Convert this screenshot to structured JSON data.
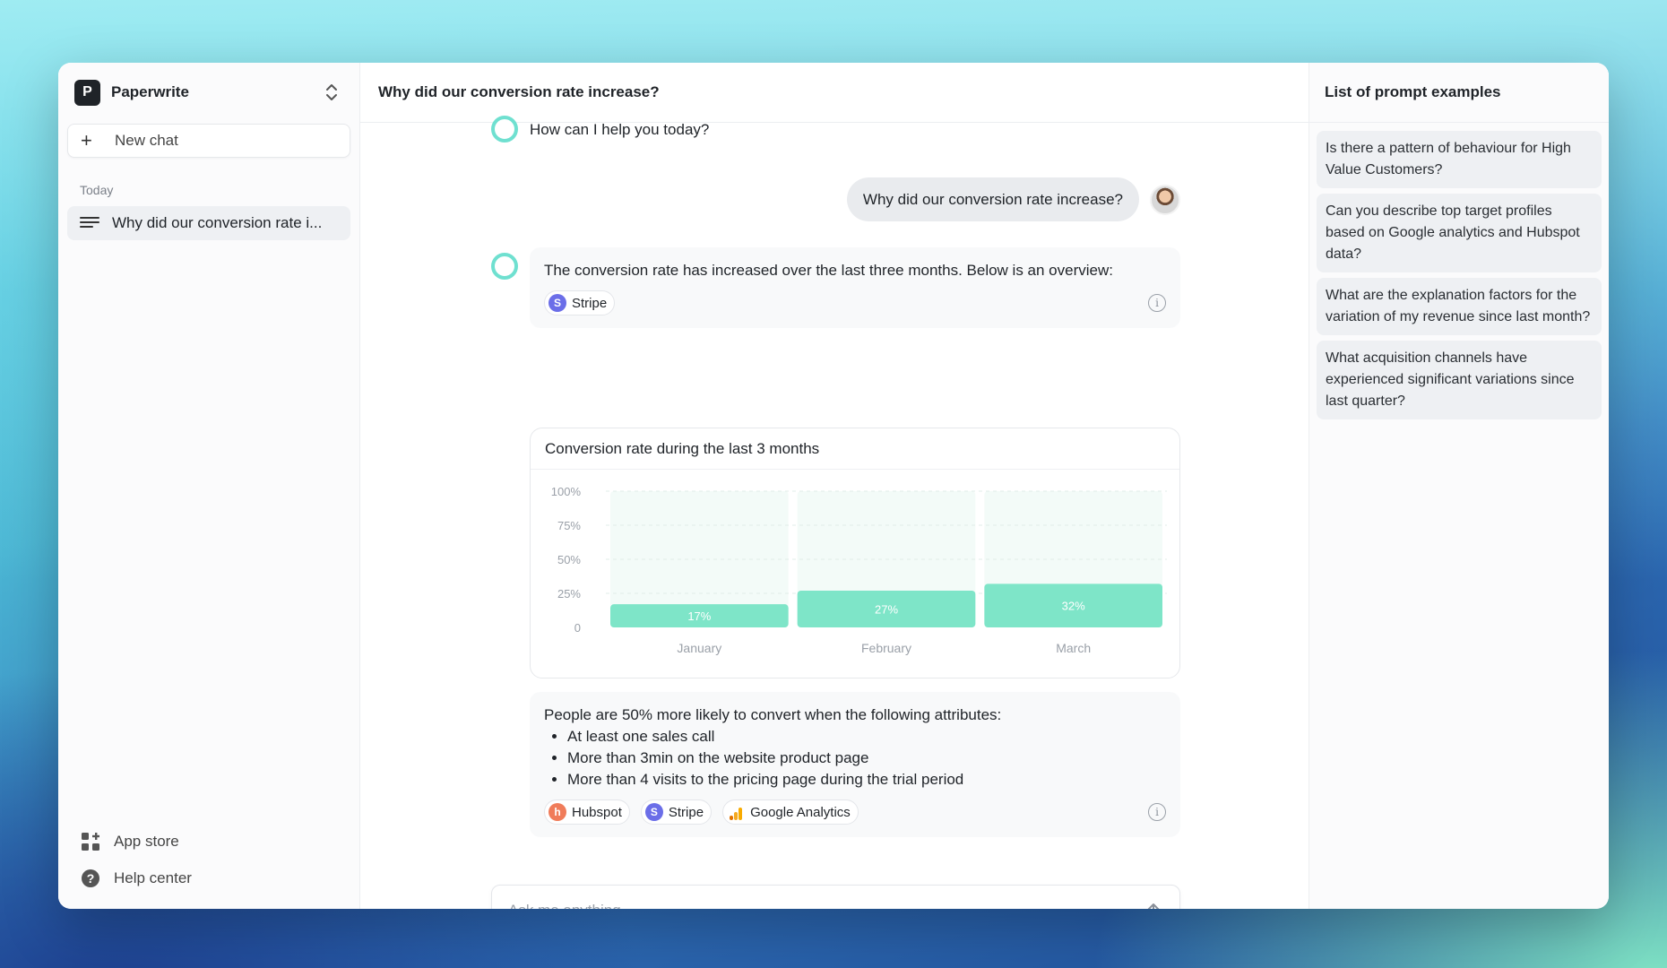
{
  "app": {
    "workspace_name": "Paperwrite",
    "workspace_initial": "P"
  },
  "sidebar": {
    "new_chat_label": "New chat",
    "section_today": "Today",
    "history": [
      {
        "label": "Why did our conversion rate i..."
      }
    ],
    "bottom_links": [
      {
        "label": "App store",
        "icon": "app-store-icon"
      },
      {
        "label": "Help center",
        "icon": "help-icon"
      }
    ]
  },
  "main": {
    "title": "Why did our conversion rate increase?",
    "greeting": "How can I help you today?",
    "user_message": "Why did our conversion rate increase?",
    "answer_1": {
      "text": "The conversion rate has increased over the last three months. Below is an overview:",
      "sources": [
        {
          "label": "Stripe",
          "initial": "S",
          "color": "#6b6ee8"
        }
      ]
    },
    "answer_2": {
      "intro": "People are 50% more likely to convert when the following attributes:",
      "bullets": [
        "At least one sales call",
        "More than 3min on the website product page",
        "More than 4 visits to the pricing page during the trial period"
      ],
      "sources": [
        {
          "label": "Hubspot",
          "initial": "h",
          "color": "#f07c5a"
        },
        {
          "label": "Stripe",
          "initial": "S",
          "color": "#6b6ee8"
        },
        {
          "label": "Google Analytics",
          "initial": "",
          "color": "#f4a922"
        }
      ]
    },
    "input_placeholder": "Ask me anything..."
  },
  "right_panel": {
    "title": "List of prompt examples",
    "prompts": [
      "Is there a pattern of behaviour for High Value Customers?",
      "Can you describe top target profiles based on Google analytics and Hubspot data?",
      "What are the explanation factors for the variation of my revenue since last month?",
      "What acquisition channels have experienced significant variations since last quarter?"
    ]
  },
  "chart_data": {
    "type": "bar",
    "title": "Conversion rate during the last 3 months",
    "categories": [
      "January",
      "February",
      "March"
    ],
    "values": [
      17,
      27,
      32
    ],
    "value_labels": [
      "17%",
      "27%",
      "32%"
    ],
    "yticks": [
      "0",
      "25%",
      "50%",
      "75%",
      "100%"
    ],
    "ylim": [
      0,
      100
    ],
    "bar_color": "#7ee5c8",
    "track_color": "#f3fbf8",
    "grid": true
  }
}
